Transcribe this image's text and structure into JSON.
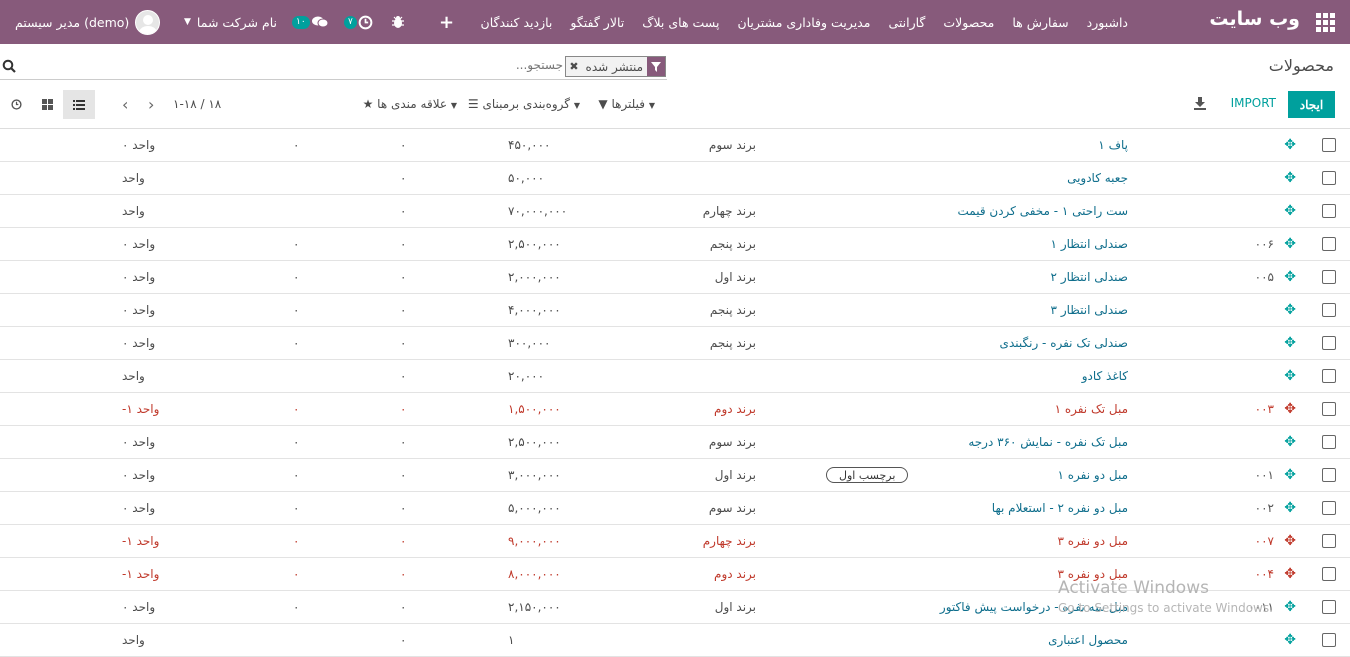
{
  "navbar": {
    "brand": "وب سایت",
    "menu": [
      "داشبورد",
      "سفارش ها",
      "محصولات",
      "گارانتی",
      "مدیریت وفاداری مشتریان",
      "پست های بلاگ",
      "تالار گفتگو",
      "بازدید کنندگان"
    ],
    "add_icon": "plus-icon",
    "debug_icon": "bug-icon",
    "activity_count": "۷",
    "messages_count": "۱۰",
    "company": "نام شرکت شما",
    "user": "مدیر سیستم (demo)",
    "bg_color": "#875a7b"
  },
  "control_panel": {
    "title": "محصولات",
    "search": {
      "facet_value": "منتشر شده",
      "placeholder": "جستجو..."
    },
    "create_label": "ایجاد",
    "import_label": "IMPORT",
    "filters_label": "فیلترها",
    "groupby_label": "گروه‌بندی برمبنای",
    "favorites_label": "علاقه مندی ها",
    "pager": "۱-۱۸ / ۱۸",
    "accent_color": "#00a09d"
  },
  "rows": [
    {
      "ref": "",
      "name": "پاف ۱",
      "tag": "",
      "brand": "برند سوم",
      "price": "۴۵۰,۰۰۰",
      "c1": "۰",
      "c2": "۰",
      "qty": "۰  واحد",
      "red": false
    },
    {
      "ref": "",
      "name": "جعبه کادویی",
      "tag": "",
      "brand": "",
      "price": "۵۰,۰۰۰",
      "c1": "۰",
      "c2": "",
      "qty": "واحد",
      "red": false
    },
    {
      "ref": "",
      "name": "ست راحتی ۱ - مخفی کردن قیمت",
      "tag": "",
      "brand": "برند چهارم",
      "price": "۷۰,۰۰۰,۰۰۰",
      "c1": "۰",
      "c2": "",
      "qty": "واحد",
      "red": false
    },
    {
      "ref": "۰۰۶",
      "name": "صندلی انتظار ۱",
      "tag": "",
      "brand": "برند پنجم",
      "price": "۲,۵۰۰,۰۰۰",
      "c1": "۰",
      "c2": "۰",
      "qty": "۰  واحد",
      "red": false
    },
    {
      "ref": "۰۰۵",
      "name": "صندلی انتظار ۲",
      "tag": "",
      "brand": "برند اول",
      "price": "۲,۰۰۰,۰۰۰",
      "c1": "۰",
      "c2": "۰",
      "qty": "۰  واحد",
      "red": false
    },
    {
      "ref": "",
      "name": "صندلی انتظار ۳",
      "tag": "",
      "brand": "برند پنجم",
      "price": "۴,۰۰۰,۰۰۰",
      "c1": "۰",
      "c2": "۰",
      "qty": "۰  واحد",
      "red": false
    },
    {
      "ref": "",
      "name": "صندلی تک نفره - رنگبندی",
      "tag": "",
      "brand": "برند پنجم",
      "price": "۳۰۰,۰۰۰",
      "c1": "۰",
      "c2": "۰",
      "qty": "۰  واحد",
      "red": false
    },
    {
      "ref": "",
      "name": "کاغذ کادو",
      "tag": "",
      "brand": "",
      "price": "۲۰,۰۰۰",
      "c1": "۰",
      "c2": "",
      "qty": "واحد",
      "red": false
    },
    {
      "ref": "۰۰۳",
      "name": "مبل تک نفره ۱",
      "tag": "",
      "brand": "برند دوم",
      "price": "۱,۵۰۰,۰۰۰",
      "c1": "۰",
      "c2": "۰",
      "qty": "-۱  واحد",
      "red": true
    },
    {
      "ref": "",
      "name": "مبل تک نفره - نمایش ۳۶۰ درجه",
      "tag": "",
      "brand": "برند سوم",
      "price": "۲,۵۰۰,۰۰۰",
      "c1": "۰",
      "c2": "۰",
      "qty": "۰  واحد",
      "red": false
    },
    {
      "ref": "۰۰۱",
      "name": "مبل دو نفره ۱",
      "tag": "برچسب اول",
      "brand": "برند اول",
      "price": "۳,۰۰۰,۰۰۰",
      "c1": "۰",
      "c2": "۰",
      "qty": "۰  واحد",
      "red": false
    },
    {
      "ref": "۰۰۲",
      "name": "مبل دو نفره ۲ - استعلام بها",
      "tag": "",
      "brand": "برند سوم",
      "price": "۵,۰۰۰,۰۰۰",
      "c1": "۰",
      "c2": "۰",
      "qty": "۰  واحد",
      "red": false
    },
    {
      "ref": "۰۰۷",
      "name": "مبل دو نفره ۳",
      "tag": "",
      "brand": "برند چهارم",
      "price": "۹,۰۰۰,۰۰۰",
      "c1": "۰",
      "c2": "۰",
      "qty": "-۱  واحد",
      "red": true
    },
    {
      "ref": "۰۰۴",
      "name": "مبل دو نفره ۳",
      "tag": "",
      "brand": "برند دوم",
      "price": "۸,۰۰۰,۰۰۰",
      "c1": "۰",
      "c2": "۰",
      "qty": "-۱  واحد",
      "red": true
    },
    {
      "ref": "۰۰۱۱",
      "name": "مبل سه نفره - درخواست پیش فاکتور",
      "tag": "",
      "brand": "برند اول",
      "price": "۲,۱۵۰,۰۰۰",
      "c1": "۰",
      "c2": "۰",
      "qty": "۰  واحد",
      "red": false
    },
    {
      "ref": "",
      "name": "محصول اعتباری",
      "tag": "",
      "brand": "",
      "price": "۱",
      "c1": "۰",
      "c2": "",
      "qty": "واحد",
      "red": false
    }
  ],
  "watermark": {
    "line1": "Activate Windows",
    "line2": "Go to Settings to activate Windows."
  }
}
